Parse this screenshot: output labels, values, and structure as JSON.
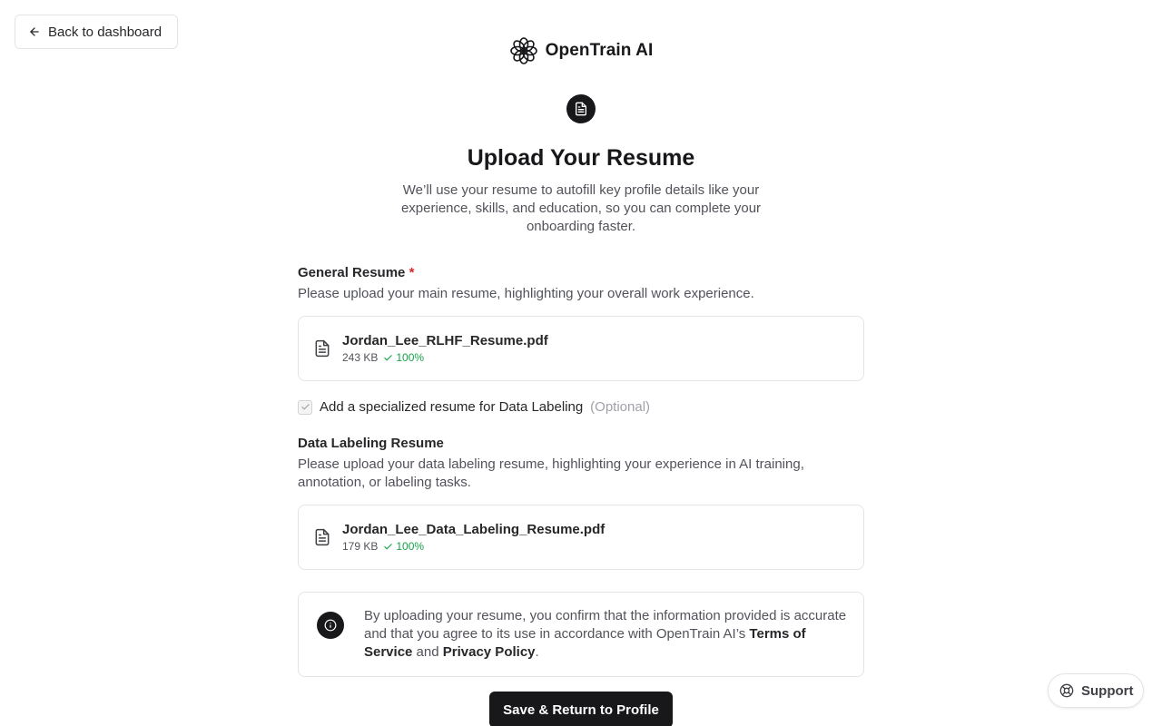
{
  "nav": {
    "back_label": "Back to dashboard"
  },
  "brand": {
    "name": "OpenTrain AI"
  },
  "header": {
    "title": "Upload Your Resume",
    "subtitle": "We’ll use your resume to autofill key profile details like your experience, skills, and education, so you can complete your onboarding faster."
  },
  "general_resume": {
    "label": "General Resume",
    "required_mark": "*",
    "description": "Please upload your main resume, highlighting your overall work experience.",
    "file": {
      "name": "Jordan_Lee_RLHF_Resume.pdf",
      "size": "243 KB",
      "progress": "100%"
    }
  },
  "specialized_option": {
    "label": "Add a specialized resume for Data Labeling",
    "optional_label": "(Optional)",
    "checked": true
  },
  "data_labeling_resume": {
    "label": "Data Labeling Resume",
    "description": "Please upload your data labeling resume, highlighting your experience in AI training, annotation, or labeling tasks.",
    "file": {
      "name": "Jordan_Lee_Data_Labeling_Resume.pdf",
      "size": "179 KB",
      "progress": "100%"
    }
  },
  "notice": {
    "text_before": "By uploading your resume, you confirm that the information provided is accurate and that you agree to its use in accordance with OpenTrain AI’s ",
    "terms_link": "Terms of Service",
    "and": " and ",
    "privacy_link": "Privacy Policy",
    "period": "."
  },
  "actions": {
    "save_label": "Save & Return to Profile"
  },
  "support": {
    "label": "Support"
  },
  "icons": {
    "back": "arrow-left-icon",
    "logo": "flower-logo-icon",
    "hero": "document-icon",
    "file": "file-text-icon",
    "check": "check-icon",
    "info": "info-icon",
    "support": "lifebuoy-icon"
  },
  "colors": {
    "primary": "#18181b",
    "success": "#16a34a",
    "required": "#dc2626",
    "muted": "#52525b"
  }
}
